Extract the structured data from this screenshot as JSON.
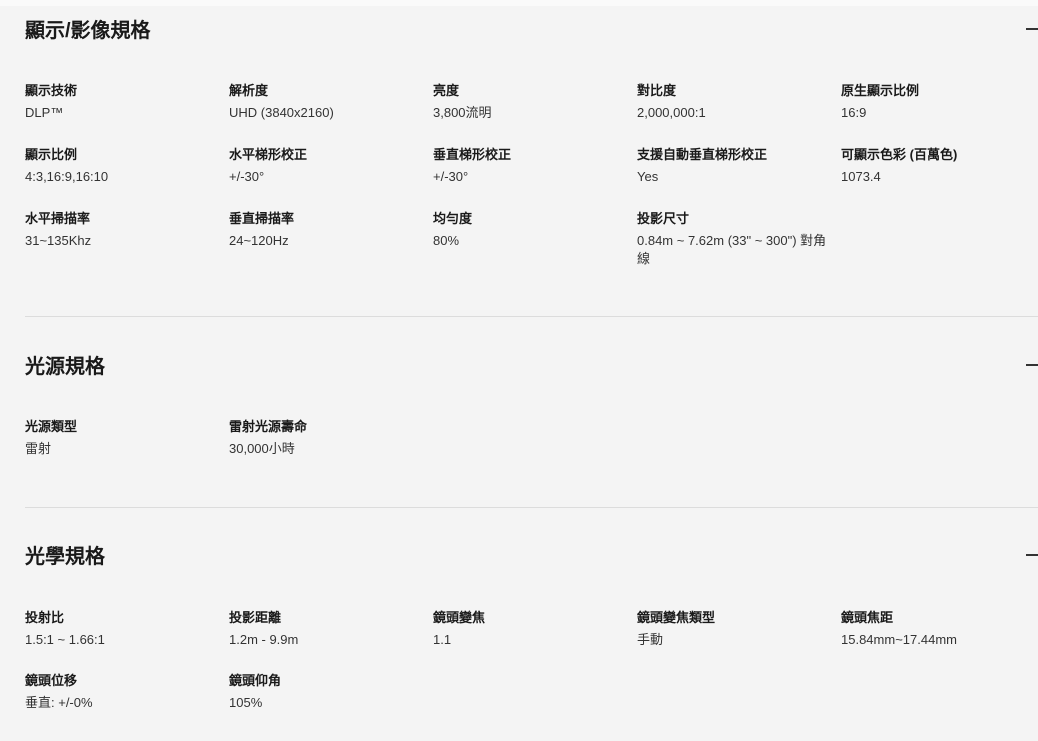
{
  "sections": [
    {
      "title": "顯示/影像規格",
      "toggle": "–",
      "specs": [
        {
          "label": "顯示技術",
          "value": "DLP™"
        },
        {
          "label": "解析度",
          "value": "UHD (3840x2160)"
        },
        {
          "label": "亮度",
          "value": "3,800流明"
        },
        {
          "label": "對比度",
          "value": "2,000,000:1"
        },
        {
          "label": "原生顯示比例",
          "value": "16:9"
        },
        {
          "label": "顯示比例",
          "value": "4:3,16:9,16:10"
        },
        {
          "label": "水平梯形校正",
          "value": "+/-30°"
        },
        {
          "label": "垂直梯形校正",
          "value": "+/-30°"
        },
        {
          "label": "支援自動垂直梯形校正",
          "value": "Yes"
        },
        {
          "label": "可顯示色彩 (百萬色)",
          "value": "1073.4"
        },
        {
          "label": "水平掃描率",
          "value": "31~135Khz"
        },
        {
          "label": "垂直掃描率",
          "value": "24~120Hz"
        },
        {
          "label": "均勻度",
          "value": "80%"
        },
        {
          "label": "投影尺寸",
          "value": "0.84m ~ 7.62m (33\" ~ 300\") 對角線"
        }
      ]
    },
    {
      "title": "光源規格",
      "toggle": "–",
      "specs": [
        {
          "label": "光源類型",
          "value": "雷射"
        },
        {
          "label": "雷射光源壽命",
          "value": "30,000小時"
        }
      ]
    },
    {
      "title": "光學規格",
      "toggle": "–",
      "specs": [
        {
          "label": "投射比",
          "value": "1.5:1 ~ 1.66:1"
        },
        {
          "label": "投影距離",
          "value": "1.2m - 9.9m"
        },
        {
          "label": "鏡頭變焦",
          "value": "1.1"
        },
        {
          "label": "鏡頭變焦類型",
          "value": "手動"
        },
        {
          "label": "鏡頭焦距",
          "value": "15.84mm~17.44mm"
        },
        {
          "label": "鏡頭位移",
          "value": "垂直: +/-0%"
        },
        {
          "label": "鏡頭仰角",
          "value": "105%"
        }
      ]
    }
  ]
}
